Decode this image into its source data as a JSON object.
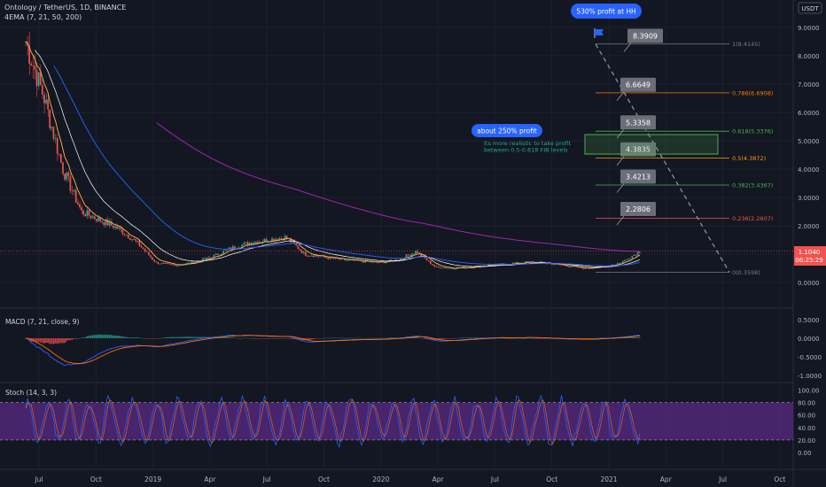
{
  "header": {
    "symbol_line": "Ontology / TetherUS, 1D, BINANCE",
    "indicator_line": "4EMA (7, 21, 50, 200)",
    "currency": "USDT"
  },
  "price_axis": {
    "ticks": [
      "9.0000",
      "8.0000",
      "7.0000",
      "6.0000",
      "5.0000",
      "4.0000",
      "3.0000",
      "2.0000",
      "1.0000",
      "0.0000"
    ],
    "current_price": "1.1040",
    "countdown": "06:25:29"
  },
  "macd": {
    "label": "MACD (7, 21, close, 9)",
    "ticks": [
      "0.5000",
      "0.0000",
      "-0.5000",
      "-1.0000"
    ]
  },
  "stoch": {
    "label": "Stoch (14, 3, 3)",
    "ticks": [
      "100.00",
      "80.00",
      "60.00",
      "40.00",
      "20.00",
      "0.00"
    ]
  },
  "time_axis": [
    "Jul",
    "Oct",
    "2019",
    "Apr",
    "Jul",
    "Oct",
    "2020",
    "Apr",
    "Jul",
    "Oct",
    "2021",
    "Apr",
    "Jul",
    "Oct"
  ],
  "annotations": {
    "profit_hh": "530% profit at HH",
    "profit_250": "about 250% profit",
    "note_line1": "Its more realistic to take profit",
    "note_line2": "between 0.5-0.618 FIB levels"
  },
  "fib_levels": [
    {
      "label": "1(8.4145)",
      "value": 8.4145,
      "color": "#787b86"
    },
    {
      "label": "0.786(6.6908)",
      "value": 6.6908,
      "color": "#f57c00"
    },
    {
      "label": "0.618(5.3376)",
      "value": 5.3376,
      "color": "#4caf50"
    },
    {
      "label": "0.5(4.3872)",
      "value": 4.3872,
      "color": "#ff9800"
    },
    {
      "label": "0.382(3.4367)",
      "value": 3.4367,
      "color": "#4caf50"
    },
    {
      "label": "0.236(2.2607)",
      "value": 2.2607,
      "color": "#ef5350"
    },
    {
      "label": "0(0.3598)",
      "value": 0.3598,
      "color": "#787b86"
    }
  ],
  "price_boxes": [
    "8.3909",
    "6.6649",
    "5.3358",
    "4.3835",
    "3.4213",
    "2.2806"
  ],
  "colors": {
    "background": "#131722",
    "up": "#26a69a",
    "down": "#ef5350",
    "ema7": "#ffb74d",
    "ema21": "#ffffff",
    "ema50": "#2962ff",
    "ema200": "#9c27b0",
    "stoch_band": "#5b2a86",
    "callout": "#2962ff",
    "price_box": "#6b6e78"
  },
  "chart_data": {
    "type": "line",
    "title": "Ontology / TetherUS, 1D, BINANCE",
    "x": [
      "2018-05",
      "2018-06",
      "2018-07",
      "2018-08",
      "2018-09",
      "2018-10",
      "2018-11",
      "2018-12",
      "2019-01",
      "2019-02",
      "2019-03",
      "2019-04",
      "2019-05",
      "2019-06",
      "2019-07",
      "2019-08",
      "2019-09",
      "2019-10",
      "2019-11",
      "2019-12",
      "2020-01",
      "2020-02",
      "2020-03",
      "2020-04",
      "2020-05",
      "2020-06",
      "2020-07",
      "2020-08",
      "2020-09",
      "2020-10",
      "2020-11",
      "2020-12",
      "2021-01",
      "2021-02"
    ],
    "series": [
      {
        "values": [
          8.5,
          6.5,
          4.0,
          2.5,
          2.2,
          1.9,
          1.4,
          0.7,
          0.6,
          0.7,
          0.9,
          1.2,
          1.4,
          1.5,
          1.6,
          1.0,
          0.9,
          0.8,
          0.75,
          0.7,
          0.8,
          1.1,
          0.55,
          0.5,
          0.55,
          0.62,
          0.65,
          0.72,
          0.68,
          0.6,
          0.5,
          0.55,
          0.7,
          1.1
        ]
      }
    ],
    "ylim": [
      0,
      9.5
    ],
    "y_ticks": [
      0,
      1,
      2,
      3,
      4,
      5,
      6,
      7,
      8,
      9
    ]
  }
}
